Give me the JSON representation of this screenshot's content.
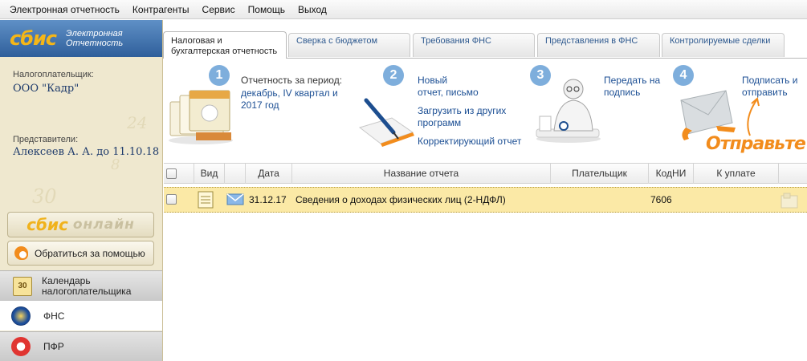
{
  "menu": [
    "Электронная отчетность",
    "Контрагенты",
    "Сервис",
    "Помощь",
    "Выход"
  ],
  "sidebar": {
    "logo": "сбис",
    "logo_sub_1": "Электронная",
    "logo_sub_2": "Отчетность",
    "taxpayer_label": "Налогоплательщик:",
    "taxpayer_name": "ООО \"Кадр\"",
    "representative_label": "Представители:",
    "representative_name": "Алексеев А. А. до 11.10.18",
    "online_button_1": "сбис",
    "online_button_2": "онлайн",
    "help_button": "Обратиться за помощью",
    "nav": {
      "calendar_icon_text": "30",
      "calendar_label": "Календарь налогоплательщика",
      "fns_label": "ФНС",
      "pfr_label": "ПФР"
    }
  },
  "tabs": [
    "Налоговая и бухгалтерская отчетность",
    "Сверка с бюджетом",
    "Требования ФНС",
    "Представления в ФНС",
    "Контролируемые сделки"
  ],
  "steps": {
    "s1": {
      "num": "1",
      "label": "Отчетность за период:",
      "link": "декабрь, IV квартал и 2017 год"
    },
    "s2": {
      "num": "2",
      "new_line_1": "Новый",
      "new_line_2": "отчет, письмо",
      "load": "Загрузить из других программ",
      "correct": "Корректирующий отчет"
    },
    "s3": {
      "num": "3",
      "link": "Передать на подпись"
    },
    "s4": {
      "num": "4",
      "link": "Подписать и отправить",
      "handwriting": "Отправьте"
    }
  },
  "table": {
    "headers": {
      "view": "Вид",
      "date": "Дата",
      "name": "Название отчета",
      "payer": "Плательщик",
      "code": "КодНИ",
      "pay": "К уплате"
    },
    "rows": [
      {
        "date": "31.12.17",
        "name": "Сведения о доходах физических лиц (2-НДФЛ)",
        "payer": "",
        "code": "7606",
        "pay": ""
      }
    ]
  },
  "colors": {
    "accent_orange": "#f28c1c",
    "link_blue": "#1c4f94",
    "step_blue": "#7eaedc",
    "row_highlight": "#fbe9a6",
    "logo_yellow": "#f5b617"
  }
}
